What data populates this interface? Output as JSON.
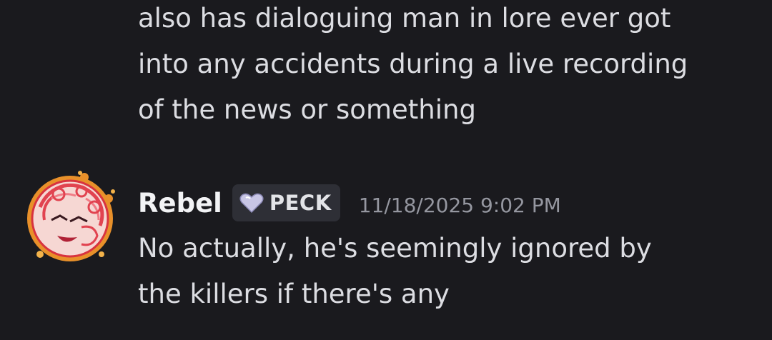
{
  "messages": [
    {
      "text": "also has dialoguing man in lore ever got\ninto any accidents during a live recording\nof the news or something"
    },
    {
      "author": "Rebel",
      "tag": {
        "icon": "heart-icon",
        "label": "PECK"
      },
      "timestamp": "11/18/2025 9:02 PM",
      "text": "No actually, he's seemingly ignored by\nthe killers if there's any"
    }
  ],
  "colors": {
    "background": "#1a1a1e",
    "text": "#dcdde2",
    "author": "#f2f3f5",
    "timestamp": "#9597a0",
    "tag_background": "#2e2f36",
    "avatar_frame": "#e8902a"
  }
}
